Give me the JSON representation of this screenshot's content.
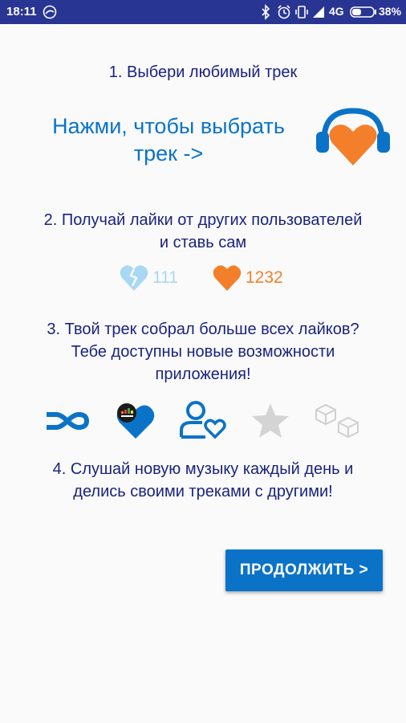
{
  "status_bar": {
    "time": "18:11",
    "network": "4G",
    "battery": "38%",
    "icons": [
      "notification-icon",
      "bluetooth-icon",
      "alarm-icon",
      "vibrate-icon",
      "signal-icon",
      "battery-icon"
    ]
  },
  "steps": {
    "step1": "1. Выбери любимый трек",
    "step2_line1": "2. Получай лайки от других пользователей",
    "step2_line2": "и ставь сам",
    "step3_line1": "3. Твой трек собрал больше всех лайков?",
    "step3_line2": "Тебе доступны новые возможности",
    "step3_line3": "приложения!",
    "step4_line1": "4. Слушай новую музыку каждый день и",
    "step4_line2": "делись своими треками с другими!"
  },
  "choose_track": {
    "line1": "Нажми, чтобы выбрать",
    "line2": "трек ->"
  },
  "likes": {
    "dislike_count": "111",
    "like_count": "1232"
  },
  "features": [
    "infinity-icon",
    "deezer-heart-icon",
    "user-heart-icon",
    "star-icon",
    "cubes-icon"
  ],
  "continue_button": "ПРОДОЛЖИТЬ >",
  "colors": {
    "primary": "#0a73c8",
    "orange": "#f47f2a",
    "light_blue": "#a8d8f3",
    "text_dark": "#1a237e",
    "status_bar": "#283593"
  }
}
